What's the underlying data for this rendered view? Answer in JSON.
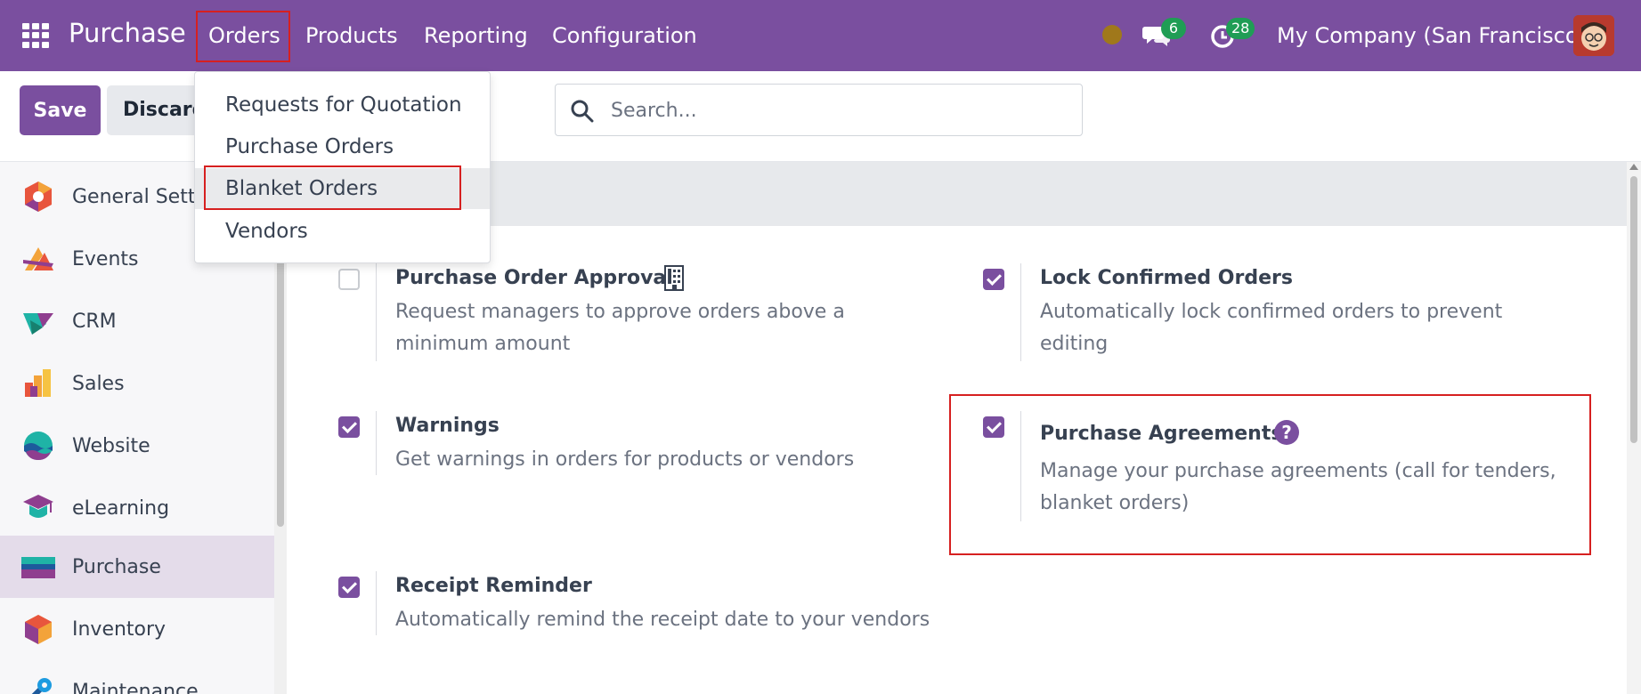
{
  "navbar": {
    "app_name": "Purchase",
    "menu": [
      "Orders",
      "Products",
      "Reporting",
      "Configuration"
    ],
    "chat_count": "6",
    "activity_count": "28",
    "company": "My Company (San Francisco)",
    "brand_color": "#7a4f9f"
  },
  "toolbar": {
    "save_label": "Save",
    "discard_label": "Discard"
  },
  "search": {
    "placeholder": "Search..."
  },
  "orders_menu": {
    "items": [
      "Requests for Quotation",
      "Purchase Orders",
      "Blanket Orders",
      "Vendors"
    ],
    "highlighted": "Blanket Orders"
  },
  "sidebar": {
    "items": [
      {
        "label": "General Settings",
        "icon": "general-settings-icon"
      },
      {
        "label": "Events",
        "icon": "events-icon"
      },
      {
        "label": "CRM",
        "icon": "crm-icon"
      },
      {
        "label": "Sales",
        "icon": "sales-icon"
      },
      {
        "label": "Website",
        "icon": "website-icon"
      },
      {
        "label": "eLearning",
        "icon": "elearning-icon"
      },
      {
        "label": "Purchase",
        "icon": "purchase-icon"
      },
      {
        "label": "Inventory",
        "icon": "inventory-icon"
      },
      {
        "label": "Maintenance",
        "icon": "maintenance-icon"
      }
    ],
    "active": "Purchase"
  },
  "settings": [
    {
      "title": "Purchase Order Approval",
      "description": "Request managers to approve orders above a minimum amount",
      "checked": false,
      "icon": "building-icon"
    },
    {
      "title": "Lock Confirmed Orders",
      "description": "Automatically lock confirmed orders to prevent editing",
      "checked": true
    },
    {
      "title": "Warnings",
      "description": "Get warnings in orders for products or vendors",
      "checked": true
    },
    {
      "title": "Purchase Agreements",
      "description": "Manage your purchase agreements (call for tenders, blanket orders)",
      "checked": true,
      "icon": "help-icon"
    },
    {
      "title": "Receipt Reminder",
      "description": "Automatically remind the receipt date to your vendors",
      "checked": true
    }
  ]
}
